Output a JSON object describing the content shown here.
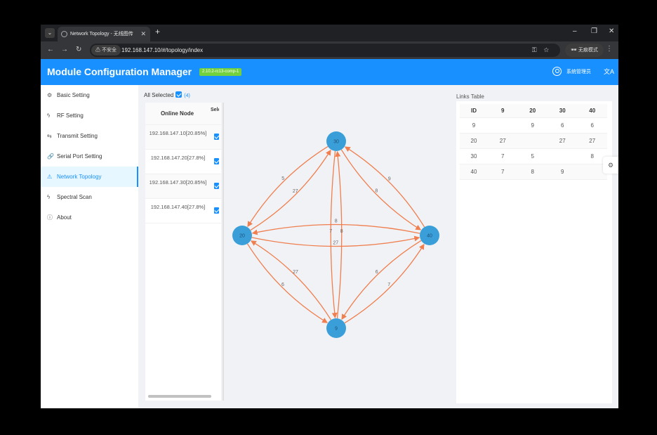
{
  "browser": {
    "tab_title": "Network Topology - 无线图传",
    "tab_close": "✕",
    "new_tab": "+",
    "insecure_label": "⚠ 不安全",
    "url": "192.168.147.10/#/topology/index",
    "profile_label": "无痕模式",
    "window_controls": [
      "–",
      "❐",
      "✕"
    ]
  },
  "app": {
    "title": "Module Configuration Manager",
    "version": "2.10.2-rc13-comp-1",
    "user": "系统管理员",
    "lang_icon": "文A"
  },
  "sidebar": {
    "items": [
      {
        "label": "Basic Setting",
        "icon": "⚙"
      },
      {
        "label": "RF Setting",
        "icon": "ϟ"
      },
      {
        "label": "Transmit Setting",
        "icon": "⇆"
      },
      {
        "label": "Serial Port Setting",
        "icon": "🔗"
      },
      {
        "label": "Network Topology",
        "icon": "⚠"
      },
      {
        "label": "Spectral Scan",
        "icon": "ϟ"
      },
      {
        "label": "About",
        "icon": "ⓘ"
      }
    ],
    "active_index": 4
  },
  "nodes_panel": {
    "all_selected_label": "All Selected",
    "count": "(4)",
    "col_online_node": "Online Node",
    "col_select": "Select",
    "rows": [
      {
        "ip": "192.168.147.10[20.85%]"
      },
      {
        "ip": "192.168.147.20[27.8%]"
      },
      {
        "ip": "192.168.147.30[20.85%]"
      },
      {
        "ip": "192.168.147.40[27.8%]"
      }
    ]
  },
  "topology": {
    "nodes": [
      {
        "id": "30"
      },
      {
        "id": "20"
      },
      {
        "id": "40"
      },
      {
        "id": "9"
      }
    ],
    "edge_labels": [
      "27",
      "5",
      "27",
      "8",
      "7",
      "8",
      "6",
      "9",
      "6",
      "7",
      "8",
      "27"
    ],
    "node_color": "#3a9fd8",
    "edge_color": "#f07e4e"
  },
  "links_table": {
    "label": "Links Table",
    "headers": [
      "ID",
      "9",
      "20",
      "30",
      "40"
    ],
    "rows": [
      [
        "9",
        "",
        "9",
        "6",
        "6"
      ],
      [
        "20",
        "27",
        "",
        "27",
        "27"
      ],
      [
        "30",
        "7",
        "5",
        "",
        "8"
      ],
      [
        "40",
        "7",
        "8",
        "9",
        ""
      ]
    ]
  },
  "float_button_icon": "⚙"
}
